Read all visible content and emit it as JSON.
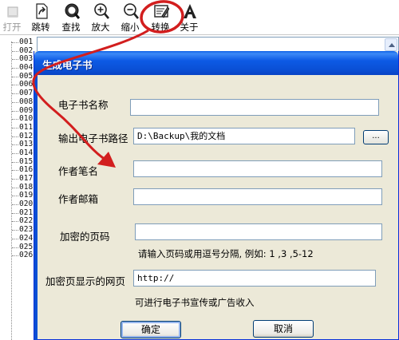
{
  "toolbar": {
    "buttons": [
      {
        "label": "打开",
        "icon": "open-icon",
        "disabled": true
      },
      {
        "label": "跳转",
        "icon": "jump-icon"
      },
      {
        "label": "查找",
        "icon": "find-icon"
      },
      {
        "label": "放大",
        "icon": "zoom-in-icon"
      },
      {
        "label": "缩小",
        "icon": "zoom-out-icon"
      },
      {
        "label": "转换",
        "icon": "convert-icon",
        "highlighted": true
      },
      {
        "label": "关于",
        "icon": "about-icon"
      }
    ]
  },
  "list": {
    "rows": [
      "001",
      "002",
      "003",
      "004",
      "005",
      "006",
      "007",
      "008",
      "009",
      "010",
      "011",
      "012",
      "013",
      "014",
      "015",
      "016",
      "017",
      "018",
      "019",
      "020",
      "021",
      "022",
      "023",
      "024",
      "025",
      "026"
    ]
  },
  "dialog": {
    "title": "生成电子书",
    "ebook_name": {
      "label": "电子书名称",
      "value": ""
    },
    "output_path": {
      "label": "输出电子书路径",
      "value": "D:\\Backup\\我的文档",
      "browse_label": "..."
    },
    "author_pen_name": {
      "label": "作者笔名",
      "value": ""
    },
    "author_email": {
      "label": "作者邮箱",
      "value": ""
    },
    "encrypted_pages": {
      "label": "加密的页码",
      "value": "",
      "hint": "请输入页码或用逗号分隔, 例如: 1 ,3 ,5-12"
    },
    "encrypted_page_url": {
      "label": "加密页显示的网页",
      "value": "http://",
      "hint": "可进行电子书宣传或广告收入"
    },
    "ok_label": "确定",
    "cancel_label": "取消"
  },
  "annotation": {
    "color": "#d21e1e"
  },
  "colors": {
    "titlebar": "#0a4fd4",
    "dialog_bg": "#ece9d8",
    "field_border": "#7f9db9"
  }
}
